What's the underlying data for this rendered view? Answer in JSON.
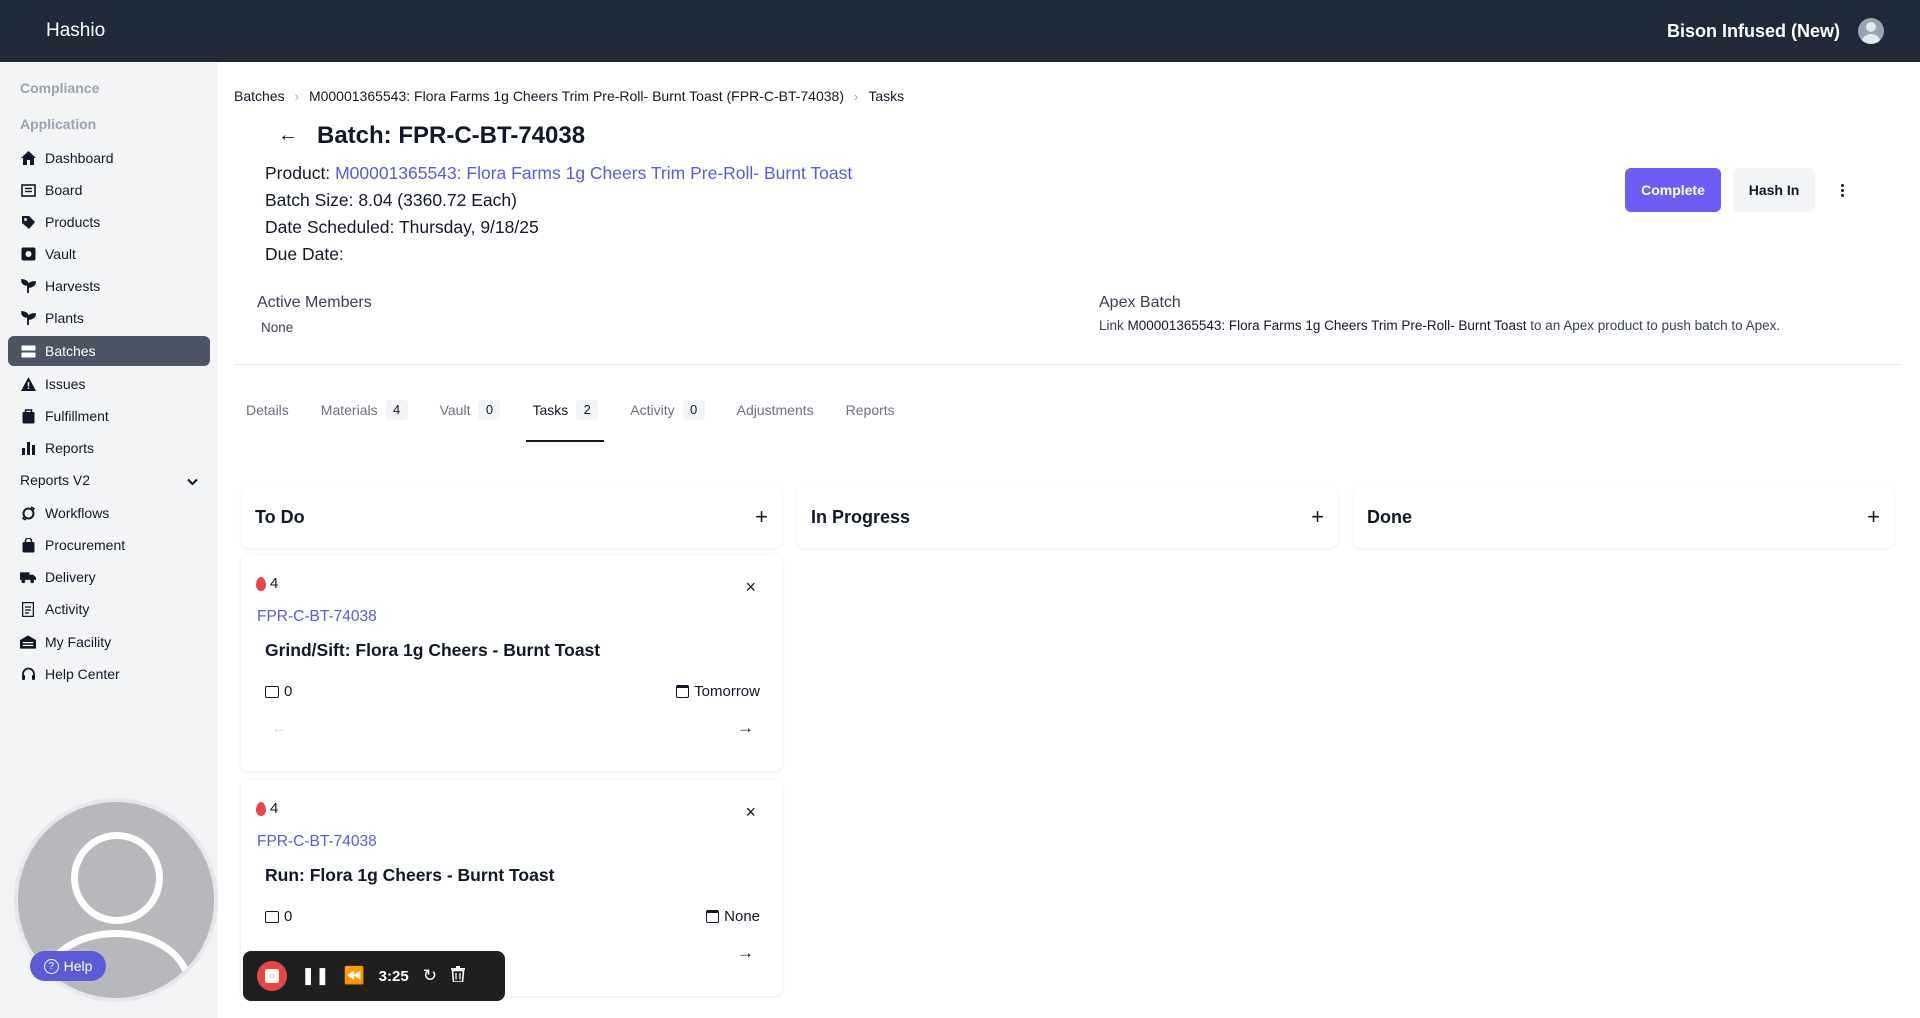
{
  "topbar": {
    "brand": "Hashio",
    "org_name": "Bison Infused (New)"
  },
  "sidebar": {
    "sections": {
      "compliance": "Compliance",
      "application": "Application"
    },
    "items": [
      {
        "label": "Dashboard",
        "icon": "home-icon"
      },
      {
        "label": "Board",
        "icon": "board-icon"
      },
      {
        "label": "Products",
        "icon": "products-icon"
      },
      {
        "label": "Vault",
        "icon": "vault-icon"
      },
      {
        "label": "Harvests",
        "icon": "harvest-icon"
      },
      {
        "label": "Plants",
        "icon": "plant-icon"
      },
      {
        "label": "Batches",
        "icon": "batches-icon",
        "active": true
      },
      {
        "label": "Issues",
        "icon": "warning-icon"
      },
      {
        "label": "Fulfillment",
        "icon": "fulfillment-icon"
      },
      {
        "label": "Reports",
        "icon": "bar-chart-icon"
      },
      {
        "label": "Reports V2",
        "icon": "chevron-down-icon"
      },
      {
        "label": "Workflows",
        "icon": "workflow-icon"
      },
      {
        "label": "Procurement",
        "icon": "bag-icon"
      },
      {
        "label": "Delivery",
        "icon": "truck-icon"
      },
      {
        "label": "Activity",
        "icon": "activity-icon"
      },
      {
        "label": "My Facility",
        "icon": "facility-icon"
      },
      {
        "label": "Help Center",
        "icon": "headset-icon"
      }
    ],
    "help_label": "Help"
  },
  "breadcrumb": [
    "Batches",
    "M00001365543: Flora Farms 1g Cheers Trim Pre-Roll- Burnt Toast (FPR-C-BT-74038)",
    "Tasks"
  ],
  "page": {
    "title": "Batch: FPR-C-BT-74038",
    "product_label": "Product:",
    "product_link": "M00001365543: Flora Farms 1g Cheers Trim Pre-Roll- Burnt Toast",
    "batch_size": "Batch Size: 8.04 (3360.72 Each)",
    "date_scheduled": "Date Scheduled: Thursday, 9/18/25",
    "due_date": "Due Date:",
    "complete_label": "Complete",
    "hash_in_label": "Hash In"
  },
  "members": {
    "title": "Active Members",
    "value": "None"
  },
  "apex": {
    "title": "Apex Batch",
    "prefix": "Link",
    "product": "M00001365543: Flora Farms 1g Cheers Trim Pre-Roll- Burnt Toast",
    "suffix": "to an Apex product to push batch to Apex."
  },
  "tabs": [
    {
      "label": "Details",
      "count": ""
    },
    {
      "label": "Materials",
      "count": "4"
    },
    {
      "label": "Vault",
      "count": "0"
    },
    {
      "label": "Tasks",
      "count": "2",
      "active": true
    },
    {
      "label": "Activity",
      "count": "0"
    },
    {
      "label": "Adjustments",
      "count": ""
    },
    {
      "label": "Reports",
      "count": ""
    }
  ],
  "columns": [
    {
      "title": "To Do"
    },
    {
      "title": "In Progress"
    },
    {
      "title": "Done"
    }
  ],
  "cards": [
    {
      "priority": "4",
      "tag": "FPR-C-BT-74038",
      "name": "Grind/Sift: Flora 1g Cheers - Burnt Toast",
      "comments": "0",
      "due": "Tomorrow"
    },
    {
      "priority": "4",
      "tag": "FPR-C-BT-74038",
      "name": "Run: Flora 1g Cheers - Burnt Toast",
      "comments": "0",
      "due": "None"
    }
  ],
  "recorder": {
    "time": "3:25"
  },
  "colors": {
    "accent": "#6d5df6",
    "link": "#5b5bd6",
    "topbar": "#1f2937",
    "priority": "#ef4444"
  }
}
